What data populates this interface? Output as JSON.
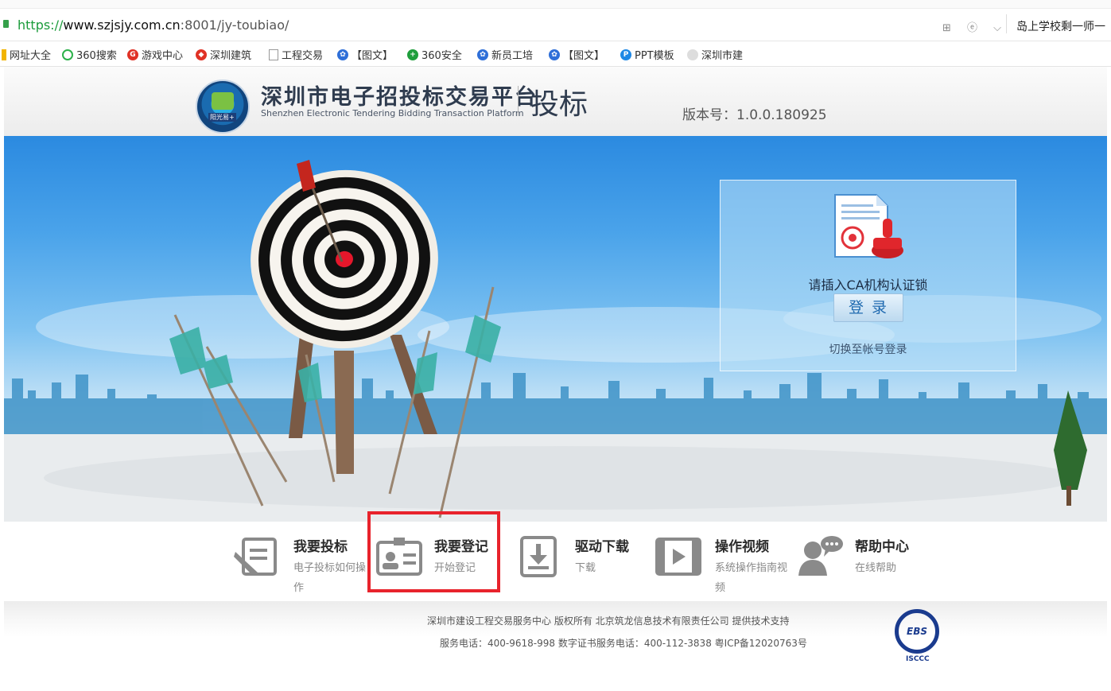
{
  "browser": {
    "url_scheme": "https://",
    "url_host": "www.szjsjy.com.cn",
    "url_path": ":8001/jy-toubiao/",
    "tab_text": "岛上学校剩一师一",
    "right_icons": "⊞ ⓔ ⌵"
  },
  "bookmarks": [
    {
      "label": "网址大全",
      "icon_color": "#f2b400"
    },
    {
      "label": "360搜索",
      "icon_color": "#2cb14a"
    },
    {
      "label": "游戏中心",
      "icon_color": "#e03226"
    },
    {
      "label": "深圳建筑",
      "icon_color": "#e03226"
    },
    {
      "label": "工程交易",
      "icon_color": "#aaaaaa"
    },
    {
      "label": "【图文】",
      "icon_color": "#2f6fd8"
    },
    {
      "label": "360安全",
      "icon_color": "#1f9e3c"
    },
    {
      "label": "新员工培",
      "icon_color": "#2f6fd8"
    },
    {
      "label": "【图文】",
      "icon_color": "#2f6fd8"
    },
    {
      "label": "PPT模板",
      "icon_color": "#1e88e5"
    },
    {
      "label": "深圳市建",
      "icon_color": "#bbbbbb"
    }
  ],
  "header": {
    "logo_tag": "阳光易+",
    "title": "深圳市电子招投标交易平台",
    "subtitle": "Shenzhen Electronic Tendering Bidding Transaction Platform",
    "module": "投标",
    "version": "版本号：1.0.0.180925"
  },
  "login": {
    "prompt": "请插入CA机构认证锁",
    "button": "登录",
    "switch_link": "切换至帐号登录"
  },
  "nav": [
    {
      "title": "我要投标",
      "sub": "电子投标如何操作",
      "icon": "edit-document-icon"
    },
    {
      "title": "我要登记",
      "sub": "开始登记",
      "icon": "id-card-icon"
    },
    {
      "title": "驱动下载",
      "sub": "下载",
      "icon": "download-icon"
    },
    {
      "title": "操作视频",
      "sub": "系统操作指南视频",
      "icon": "video-icon"
    },
    {
      "title": "帮助中心",
      "sub": "在线帮助",
      "icon": "help-chat-icon"
    }
  ],
  "footer": {
    "line1": "深圳市建设工程交易服务中心  版权所有   北京筑龙信息技术有限责任公司 提供技术支持",
    "line2": "服务电话：400-9618-998 数字证书服务电话：400-112-3838  粤ICP备12020763号",
    "badge": "EBS",
    "badge_caption": "ISCCC"
  },
  "colors": {
    "highlight": "#e8232c",
    "link_blue": "#1f6ab0"
  }
}
